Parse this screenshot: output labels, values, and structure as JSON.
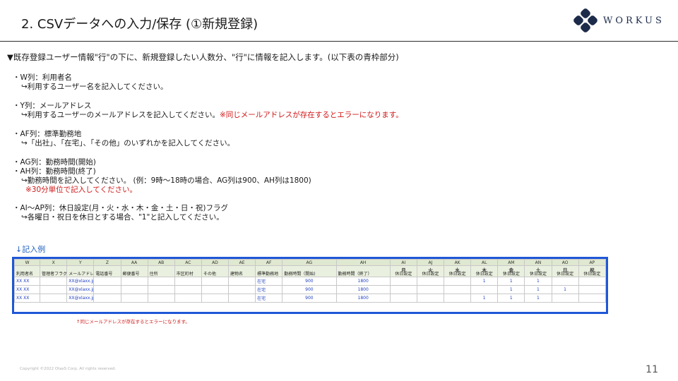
{
  "header": {
    "title": "2. CSVデータへの入力/保存 (①新規登録)",
    "logo_text": "WORKUS"
  },
  "lead": "▼既存登録ユーザー情報\"行\"の下に、新規登録したい人数分、\"行\"に情報を記入します。(以下表の青枠部分)",
  "sections": {
    "w": {
      "title": "・W列：利用者名",
      "desc": "↪利用するユーザー名を記入してください。"
    },
    "y": {
      "title": "・Y列：メールアドレス",
      "desc": "↪利用するユーザーのメールアドレスを記入してください。",
      "warn": "※同じメールアドレスが存在するとエラーになります。"
    },
    "af": {
      "title": "・AF列：標準勤務地",
      "desc": "↪「出社」、「在宅」、「その他」のいずれかを記入してください。"
    },
    "ag": {
      "title1": "・AG列：勤務時間(開始)",
      "title2": "・AH列：勤務時間(終了)",
      "desc": "↪勤務時間を記入してください。 (例：9時〜18時の場合、AG列は900、AH列は1800)",
      "warn": "※30分単位で記入してください。"
    },
    "ai": {
      "title": "・AI〜AP列：休日設定(月・火・水・木・金・土・日・祝)フラグ",
      "desc": "↪各曜日・祝日を休日とする場合、\"1\"と記入してください。"
    }
  },
  "example_label": "↓記入例",
  "sheet": {
    "columns": [
      "W",
      "X",
      "Y",
      "Z",
      "AA",
      "AB",
      "AC",
      "AD",
      "AE",
      "AF",
      "AG",
      "AH",
      "AI",
      "AJ",
      "AK",
      "AL",
      "AM",
      "AN",
      "AO",
      "AP"
    ],
    "headers": [
      "利用者名",
      "管理者フラグ",
      "メールアドレス",
      "電話番号",
      "郵便番号",
      "住所",
      "市区町村",
      "その他",
      "建物名",
      "標準勤務地",
      "勤務時間（開始)",
      "勤務時間（終了）",
      "休日設定",
      "休日設定",
      "休日設定",
      "休日設定",
      "休日設定",
      "休日設定",
      "休日設定",
      "休日設定"
    ],
    "days": [
      "",
      "",
      "",
      "",
      "",
      "",
      "",
      "",
      "",
      "",
      "",
      "",
      "月",
      "火",
      "水",
      "木",
      "金",
      "土",
      "日",
      "祝"
    ],
    "rows": [
      [
        "XX XX",
        "",
        "XX@xlaxx.jp",
        "",
        "",
        "",
        "",
        "",
        "",
        "在宅",
        "900",
        "1800",
        "",
        "",
        "",
        "1",
        "1",
        "1",
        "",
        ""
      ],
      [
        "XX XX",
        "",
        "XX@xlaxx.jp",
        "",
        "",
        "",
        "",
        "",
        "",
        "在宅",
        "900",
        "1800",
        "",
        "",
        "",
        "",
        "1",
        "1",
        "1",
        ""
      ],
      [
        "XX XX",
        "",
        "XX@xlaxx.jp",
        "",
        "",
        "",
        "",
        "",
        "",
        "在宅",
        "900",
        "1800",
        "",
        "",
        "",
        "1",
        "1",
        "1",
        "",
        ""
      ]
    ]
  },
  "below_note": "↑同じメールアドレスが存在するとエラーになります。",
  "footer": {
    "copyright": "Copyright ©2022 OtasS Corp. All rights reserved.",
    "page": "11"
  },
  "colors": {
    "accent_blue": "#1f57d6",
    "warning_red": "#d01818",
    "logo_navy": "#1c2b4a"
  }
}
